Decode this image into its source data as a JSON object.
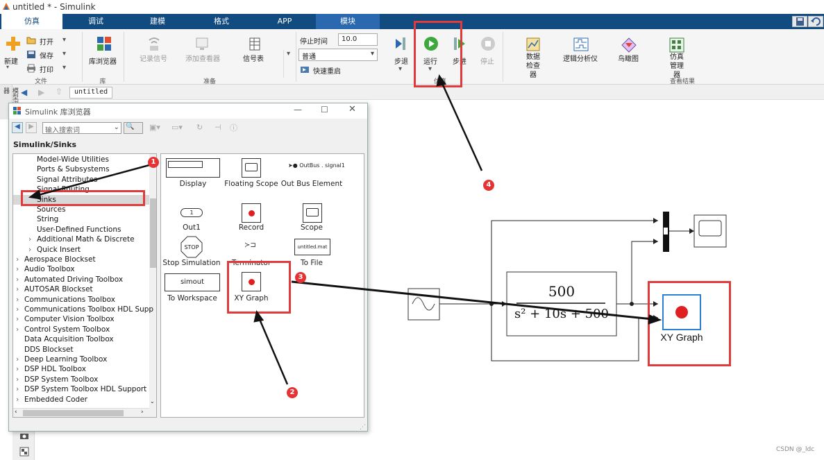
{
  "window": {
    "title": "untitled * - Simulink"
  },
  "tabs": [
    "仿真",
    "调试",
    "建模",
    "格式",
    "APP",
    "模块"
  ],
  "ribbon": {
    "new": "新建",
    "open": "打开",
    "save": "保存",
    "print": "打印",
    "group_file": "文件",
    "library_browser": "库浏览器",
    "group_library": "库",
    "log_signals": "记录信号",
    "add_viewer": "添加查看器",
    "signal_table": "信号表",
    "group_prepare": "准备",
    "stop_time_label": "停止时间",
    "stop_time_value": "10.0",
    "mode_value": "普通",
    "fast_restart": "快速重启",
    "step_back": "步退",
    "run": "运行",
    "step_forward": "步进",
    "stop": "停止",
    "group_simulate": "仿真",
    "data_inspector": "数据检查器",
    "logic_analyzer": "逻辑分析仪",
    "birds_eye": "鸟瞰图",
    "sim_manager": "仿真管理器",
    "group_review": "查看结果"
  },
  "nav": {
    "model_tab": "untitled",
    "left_strip": "模型浏览器"
  },
  "libwin": {
    "title": "Simulink 库浏览器",
    "search_placeholder": "输入搜索词",
    "path": "Simulink/Sinks",
    "tree": [
      {
        "label": "Model-Wide Utilities",
        "indent": 2,
        "arrow": false
      },
      {
        "label": "Ports & Subsystems",
        "indent": 2,
        "arrow": false
      },
      {
        "label": "Signal Attributes",
        "indent": 2,
        "arrow": false
      },
      {
        "label": "Signal Routing",
        "indent": 2,
        "arrow": false
      },
      {
        "label": "Sinks",
        "indent": 2,
        "arrow": false,
        "selected": true
      },
      {
        "label": "Sources",
        "indent": 2,
        "arrow": false
      },
      {
        "label": "String",
        "indent": 2,
        "arrow": false
      },
      {
        "label": "User-Defined Functions",
        "indent": 2,
        "arrow": false
      },
      {
        "label": "Additional Math & Discrete",
        "indent": 1,
        "arrow": true
      },
      {
        "label": "Quick Insert",
        "indent": 1,
        "arrow": true
      },
      {
        "label": "Aerospace Blockset",
        "indent": 0,
        "arrow": true
      },
      {
        "label": "Audio Toolbox",
        "indent": 0,
        "arrow": true
      },
      {
        "label": "Automated Driving Toolbox",
        "indent": 0,
        "arrow": true
      },
      {
        "label": "AUTOSAR Blockset",
        "indent": 0,
        "arrow": true
      },
      {
        "label": "Communications Toolbox",
        "indent": 0,
        "arrow": true
      },
      {
        "label": "Communications Toolbox HDL Supp",
        "indent": 0,
        "arrow": true
      },
      {
        "label": "Computer Vision Toolbox",
        "indent": 0,
        "arrow": true
      },
      {
        "label": "Control System Toolbox",
        "indent": 0,
        "arrow": true
      },
      {
        "label": "Data Acquisition Toolbox",
        "indent": 0,
        "arrow": false
      },
      {
        "label": "DDS Blockset",
        "indent": 0,
        "arrow": false
      },
      {
        "label": "Deep Learning Toolbox",
        "indent": 0,
        "arrow": true
      },
      {
        "label": "DSP HDL Toolbox",
        "indent": 0,
        "arrow": true
      },
      {
        "label": "DSP System Toolbox",
        "indent": 0,
        "arrow": true
      },
      {
        "label": "DSP System Toolbox HDL Support",
        "indent": 0,
        "arrow": true
      },
      {
        "label": "Embedded Coder",
        "indent": 0,
        "arrow": true
      }
    ],
    "blocks": {
      "display": "Display",
      "floating_scope": "Floating Scope",
      "out_bus": "Out Bus Element",
      "outbus_text": "OutBus . signal1",
      "out1": "Out1",
      "out1_text": "1",
      "record": "Record",
      "scope": "Scope",
      "stop_sim": "Stop Simulation",
      "stop_text": "STOP",
      "terminator": "Terminator",
      "to_file": "To File",
      "to_file_text": "untitled.mat",
      "to_workspace": "To Workspace",
      "to_workspace_text": "simout",
      "xy_graph": "XY Graph"
    }
  },
  "model": {
    "tf_numerator": "500",
    "tf_denominator": "s² + 10s + 500",
    "xy_label": "XY Graph"
  },
  "badges": [
    "1",
    "2",
    "3",
    "4"
  ],
  "watermark": "CSDN @_ldc"
}
